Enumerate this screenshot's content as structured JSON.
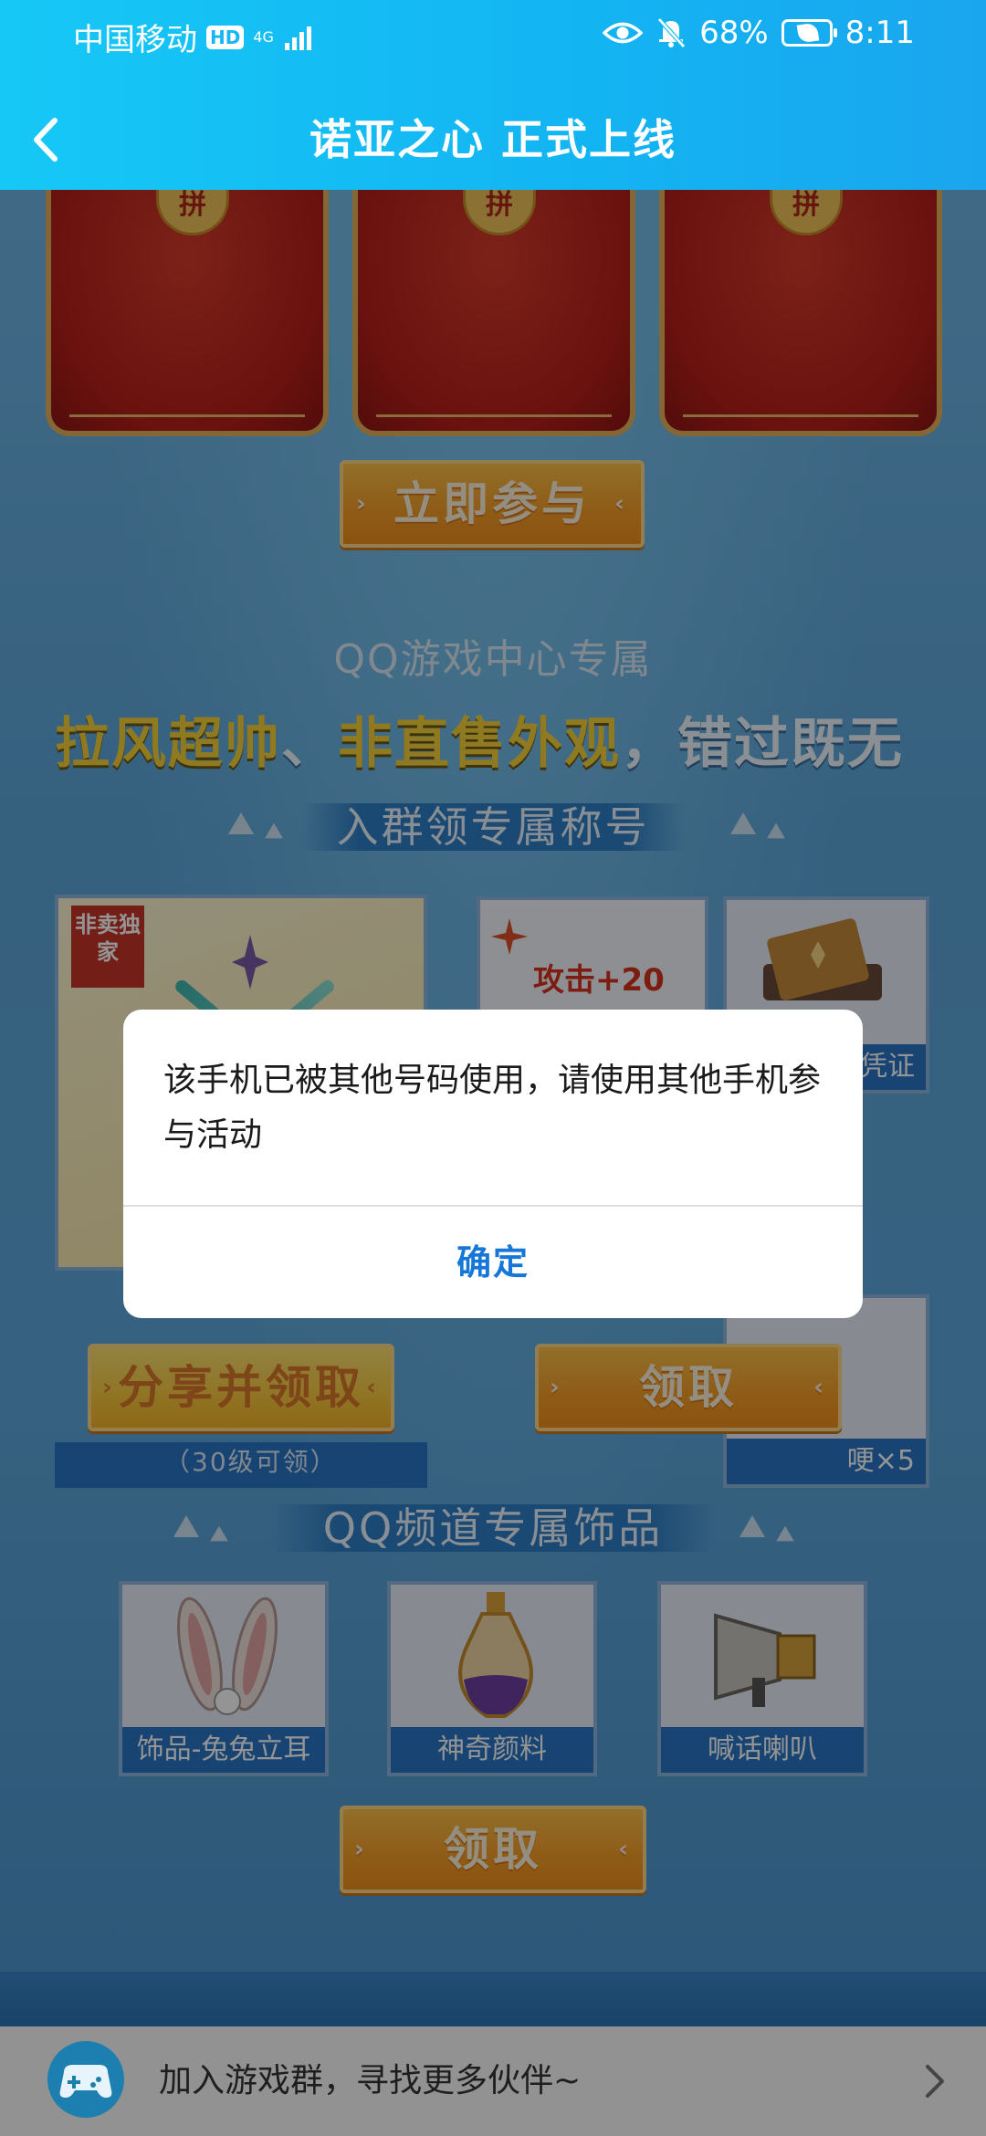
{
  "status_bar": {
    "carrier": "中国移动",
    "hd": "HD",
    "net": "4G",
    "battery": "68%",
    "time": "8:11"
  },
  "navbar": {
    "title": "诺亚之心 正式上线"
  },
  "background": {
    "envelope_seal": "拼",
    "join_button": "立即参与",
    "qq_center_title": "QQ游戏中心专属",
    "slogan_highlight_1": "拉风超帅",
    "slogan_sep": "、",
    "slogan_highlight_2": "非直售外观",
    "slogan_tail": "，错过既无",
    "group_title": "入群领专属称号",
    "badge_tag": "非卖独家",
    "attack_text": "攻击+20",
    "card_caption_tail_1": "凭证",
    "card_caption_tail_2": "）",
    "card_caption_tail_3": "哽×5",
    "share_button": "分享并领取",
    "claim_button": "领取",
    "level_note": "（30级可领）",
    "channel_title": "QQ频道专属饰品",
    "items": [
      {
        "label": "饰品-兔兔立耳"
      },
      {
        "label": "神奇颜料"
      },
      {
        "label": "喊话喇叭"
      }
    ],
    "claim_button_2": "领取"
  },
  "dialog": {
    "message": "该手机已被其他号码使用，请使用其他手机参与活动",
    "confirm": "确定"
  },
  "bottom_bar": {
    "text": "加入游戏群，寻找更多伙伴~"
  },
  "colors": {
    "header": "#16c8f6",
    "dialog_button": "#1777d8",
    "orange_button": "#f6a02a",
    "band": "#2e7fc6"
  }
}
